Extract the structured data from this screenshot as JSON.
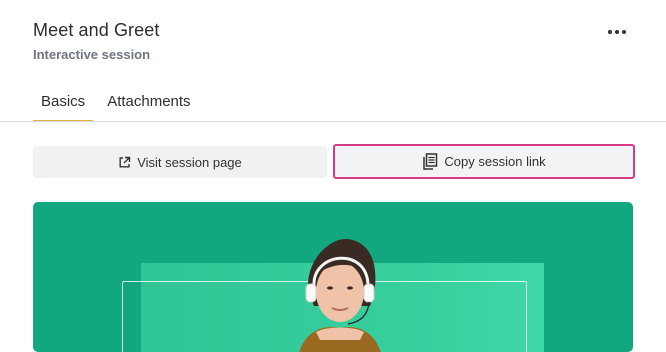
{
  "header": {
    "title": "Meet and Greet",
    "subtitle": "Interactive session",
    "more_icon": "ellipsis-icon"
  },
  "tabs": [
    {
      "label": "Basics",
      "active": true
    },
    {
      "label": "Attachments",
      "active": false
    }
  ],
  "actions": {
    "visit": {
      "label": "Visit session page",
      "icon": "external-link-icon"
    },
    "copy": {
      "label": "Copy session link",
      "icon": "copy-icon",
      "highlighted": true
    }
  },
  "colors": {
    "accent_tab": "#e3b13d",
    "highlight_border": "#d63a85",
    "hero_bg": "#12a77e"
  },
  "hero": {
    "image": "headset-woman-photo"
  }
}
